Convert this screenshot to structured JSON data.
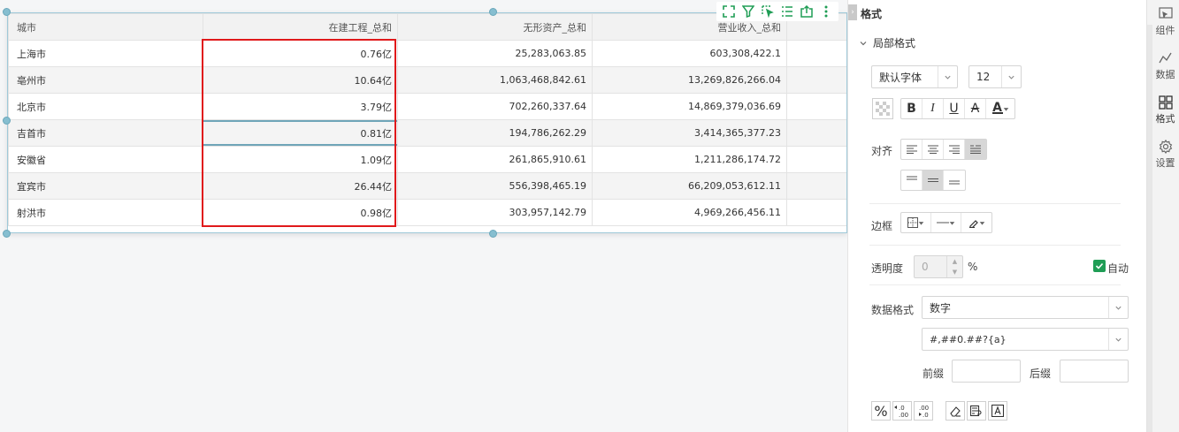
{
  "table": {
    "columns": [
      "城市",
      "在建工程_总和",
      "无形资产_总和",
      "营业收入_总和"
    ],
    "rows": [
      [
        "上海市",
        "0.76亿",
        "25,283,063.85",
        "603,308,422.1"
      ],
      [
        "亳州市",
        "10.64亿",
        "1,063,468,842.61",
        "13,269,826,266.04"
      ],
      [
        "北京市",
        "3.79亿",
        "702,260,337.64",
        "14,869,379,036.69"
      ],
      [
        "吉首市",
        "0.81亿",
        "194,786,262.29",
        "3,414,365,377.23"
      ],
      [
        "安徽省",
        "1.09亿",
        "261,865,910.61",
        "1,211,286,174.72"
      ],
      [
        "宜宾市",
        "26.44亿",
        "556,398,465.19",
        "66,209,053,612.11"
      ],
      [
        "射洪市",
        "0.98亿",
        "303,957,142.79",
        "4,969,266,456.11"
      ]
    ]
  },
  "toolbar": {
    "icons": [
      "expand-icon",
      "filter-icon",
      "select-icon",
      "list-icon",
      "export-icon",
      "more-icon"
    ]
  },
  "panel": {
    "title": "格式",
    "section": "局部格式",
    "font_family": "默认字体",
    "font_size": "12",
    "align_label": "对齐",
    "border_label": "边框",
    "opacity_label": "透明度",
    "opacity_value": "0",
    "opacity_unit": "%",
    "auto_label": "自动",
    "auto_checked": true,
    "data_format_label": "数据格式",
    "data_format_value": "数字",
    "format_pattern": "#,##0.##?{a}",
    "prefix_label": "前缀",
    "suffix_label": "后缀",
    "prefix_value": "",
    "suffix_value": ""
  },
  "rail": {
    "items": [
      {
        "label": "组件",
        "icon": "component-icon"
      },
      {
        "label": "数据",
        "icon": "data-icon"
      },
      {
        "label": "格式",
        "icon": "format-icon",
        "active": true
      },
      {
        "label": "设置",
        "icon": "settings-icon"
      }
    ]
  },
  "colors": {
    "accent_green": "#1f9d55",
    "highlight_red": "#e0191b",
    "selection_blue": "#86bed0"
  }
}
